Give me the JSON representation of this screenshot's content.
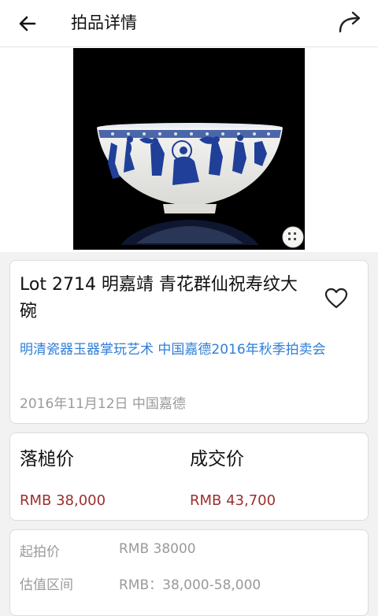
{
  "header": {
    "title": "拍品详情",
    "back_icon": "arrow-left-icon",
    "share_icon": "share-arrow-icon"
  },
  "hero": {
    "image_description": "blue-and-white porcelain bowl on black background",
    "seal_icon": "seal-stamp-icon"
  },
  "lot": {
    "title": "Lot 2714 明嘉靖  青花群仙祝寿纹大碗",
    "auction_name": "明清瓷器玉器掌玩艺术 中国嘉德2016年秋季拍卖会",
    "date_venue": "2016年11月12日 中国嘉德",
    "favorite_icon": "heart-outline-icon"
  },
  "prices": {
    "hammer_label": "落槌价",
    "hammer_value": "RMB 38,000",
    "deal_label": "成交价",
    "deal_value": "RMB 43,700",
    "price_color": "#9b2f2f"
  },
  "details": {
    "start_label": "起拍价",
    "start_value": "RMB 38000",
    "estimate_label": "估值区间",
    "estimate_value": "RMB：38,000-58,000"
  },
  "colors": {
    "link": "#2f7ed8",
    "muted": "#9a9a9a"
  }
}
